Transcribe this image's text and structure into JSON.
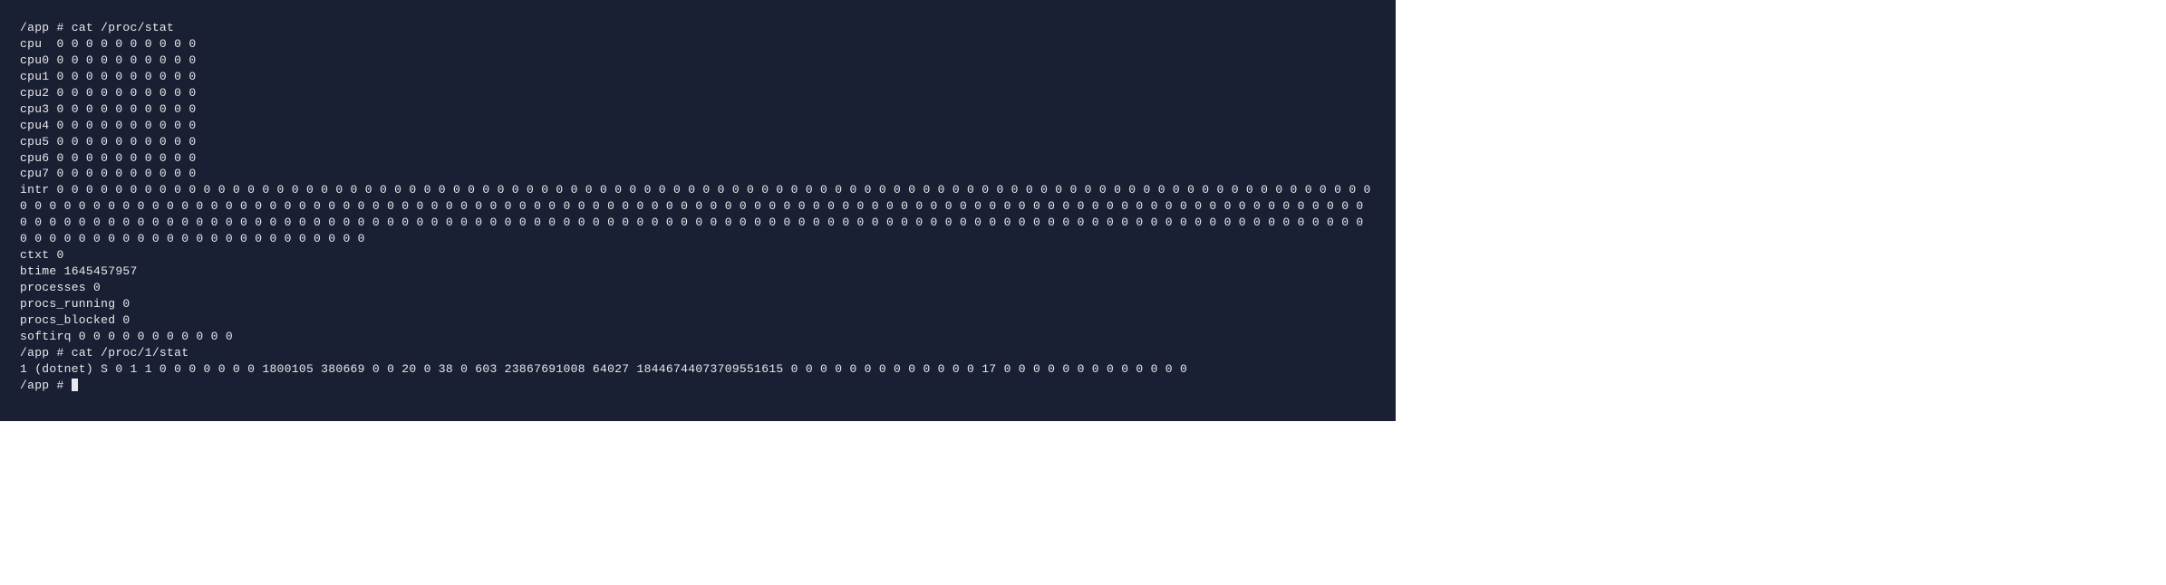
{
  "terminal": {
    "prompt1": "/app # ",
    "cmd1": "cat /proc/stat",
    "out1_cpu": "cpu  0 0 0 0 0 0 0 0 0 0",
    "out1_cpu0": "cpu0 0 0 0 0 0 0 0 0 0 0",
    "out1_cpu1": "cpu1 0 0 0 0 0 0 0 0 0 0",
    "out1_cpu2": "cpu2 0 0 0 0 0 0 0 0 0 0",
    "out1_cpu3": "cpu3 0 0 0 0 0 0 0 0 0 0",
    "out1_cpu4": "cpu4 0 0 0 0 0 0 0 0 0 0",
    "out1_cpu5": "cpu5 0 0 0 0 0 0 0 0 0 0",
    "out1_cpu6": "cpu6 0 0 0 0 0 0 0 0 0 0",
    "out1_cpu7": "cpu7 0 0 0 0 0 0 0 0 0 0",
    "out1_intr": "intr 0 0 0 0 0 0 0 0 0 0 0 0 0 0 0 0 0 0 0 0 0 0 0 0 0 0 0 0 0 0 0 0 0 0 0 0 0 0 0 0 0 0 0 0 0 0 0 0 0 0 0 0 0 0 0 0 0 0 0 0 0 0 0 0 0 0 0 0 0 0 0 0 0 0 0 0 0 0 0 0 0 0 0 0 0 0 0 0 0 0 0 0 0 0 0 0 0 0 0 0 0 0 0 0 0 0 0 0 0 0 0 0 0 0 0 0 0 0 0 0 0 0 0 0 0 0 0 0 0 0 0 0 0 0 0 0 0 0 0 0 0 0 0 0 0 0 0 0 0 0 0 0 0 0 0 0 0 0 0 0 0 0 0 0 0 0 0 0 0 0 0 0 0 0 0 0 0 0 0 0 0 0 0 0 0 0 0 0 0 0 0 0 0 0 0 0 0 0 0 0 0 0 0 0 0 0 0 0 0 0 0 0 0 0 0 0 0 0 0 0 0 0 0 0 0 0 0 0 0 0 0 0 0 0 0 0 0 0 0 0 0 0 0 0 0 0 0 0 0 0 0 0 0 0 0 0 0 0 0 0 0 0 0 0 0 0 0 0 0 0 0 0 0 0 0 0 0 0 0 0 0 0 0 0 0 0 0 0 0 0 0 0 0 0 0 0 0 0",
    "out1_ctxt": "ctxt 0",
    "out1_btime": "btime 1645457957",
    "out1_processes": "processes 0",
    "out1_procs_running": "procs_running 0",
    "out1_procs_blocked": "procs_blocked 0",
    "out1_softirq": "softirq 0 0 0 0 0 0 0 0 0 0 0",
    "prompt2": "/app # ",
    "cmd2": "cat /proc/1/stat",
    "out2": "1 (dotnet) S 0 1 1 0 0 0 0 0 0 0 1800105 380669 0 0 20 0 38 0 603 23867691008 64027 18446744073709551615 0 0 0 0 0 0 0 0 0 0 0 0 0 17 0 0 0 0 0 0 0 0 0 0 0 0 0",
    "prompt3": "/app # "
  }
}
